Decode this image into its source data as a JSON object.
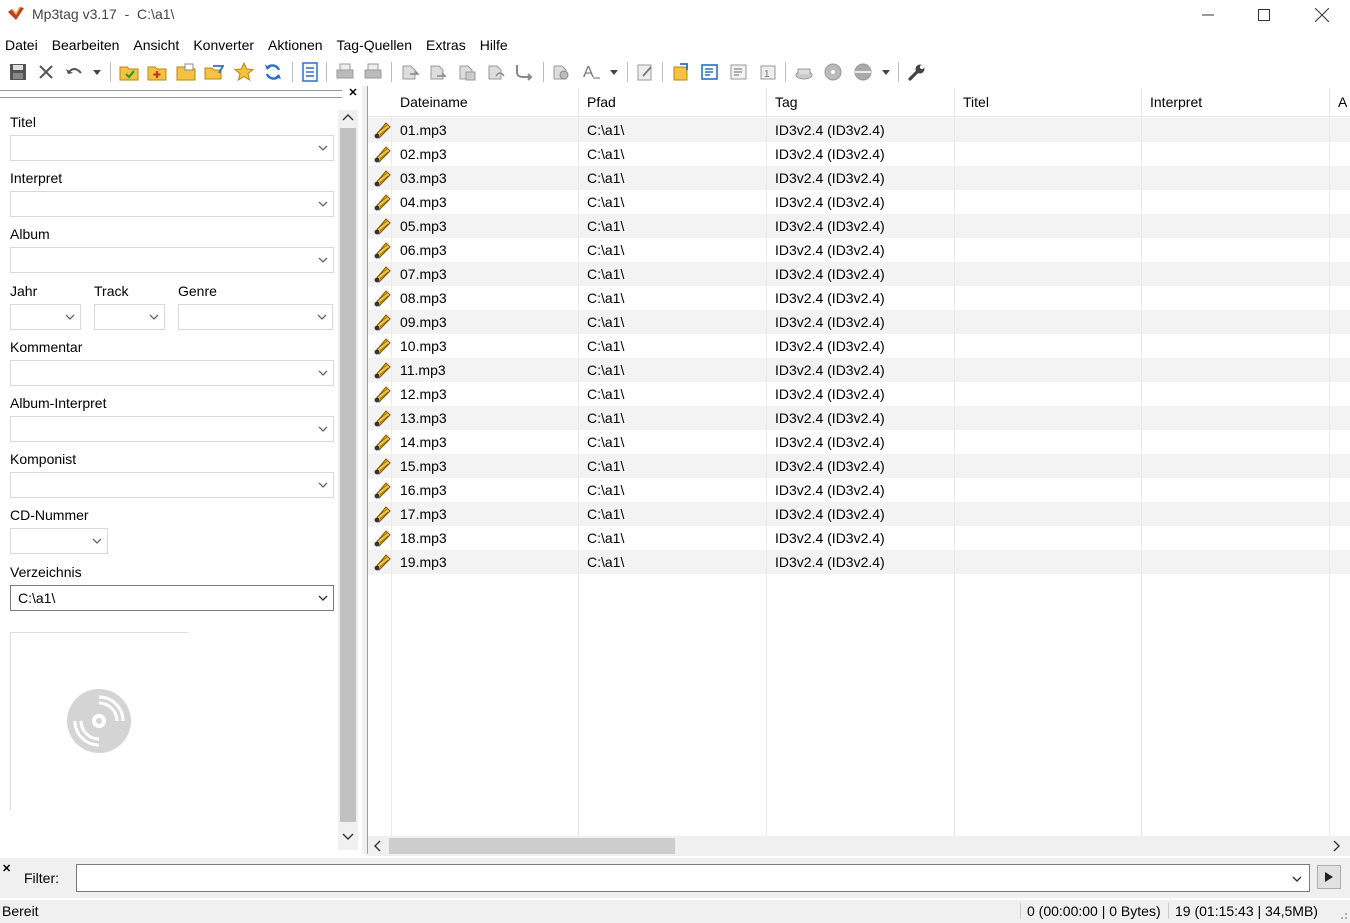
{
  "window": {
    "title": "Mp3tag v3.17  -  C:\\a1\\"
  },
  "menu": [
    "Datei",
    "Bearbeiten",
    "Ansicht",
    "Konverter",
    "Aktionen",
    "Tag-Quellen",
    "Extras",
    "Hilfe"
  ],
  "toolbar": {
    "icons": [
      "save-icon",
      "remove-tag-icon",
      "undo-icon",
      "change-directory-icon",
      "add-directory-icon",
      "favorites-folder-icon",
      "open-folder-icon",
      "favorites-star-icon",
      "refresh-icon",
      "tag-panel-icon",
      "print-icon",
      "print-preview-icon",
      "tag-filename-icon",
      "filename-tag-icon",
      "text-file-tag-icon",
      "tag-tag-icon",
      "filename-filename-icon",
      "actions-icon",
      "quick-action-icon",
      "extended-tags-icon",
      "playlist-icon",
      "export-icon",
      "import-icon",
      "autonumbering-icon",
      "freedb-icon",
      "discogs-icon",
      "tag-sources-icon",
      "options-icon"
    ]
  },
  "panel": {
    "labels": {
      "title": "Titel",
      "artist": "Interpret",
      "album": "Album",
      "year": "Jahr",
      "track": "Track",
      "genre": "Genre",
      "comment": "Kommentar",
      "album_artist": "Album-Interpret",
      "composer": "Komponist",
      "cd_number": "CD-Nummer",
      "directory": "Verzeichnis"
    },
    "directory_value": "C:\\a1\\"
  },
  "list": {
    "columns": [
      "Dateiname",
      "Pfad",
      "Tag",
      "Titel",
      "Interpret",
      "A"
    ],
    "rows": [
      {
        "file": "01.mp3",
        "path": "C:\\a1\\",
        "tag": "ID3v2.4 (ID3v2.4)"
      },
      {
        "file": "02.mp3",
        "path": "C:\\a1\\",
        "tag": "ID3v2.4 (ID3v2.4)"
      },
      {
        "file": "03.mp3",
        "path": "C:\\a1\\",
        "tag": "ID3v2.4 (ID3v2.4)"
      },
      {
        "file": "04.mp3",
        "path": "C:\\a1\\",
        "tag": "ID3v2.4 (ID3v2.4)"
      },
      {
        "file": "05.mp3",
        "path": "C:\\a1\\",
        "tag": "ID3v2.4 (ID3v2.4)"
      },
      {
        "file": "06.mp3",
        "path": "C:\\a1\\",
        "tag": "ID3v2.4 (ID3v2.4)"
      },
      {
        "file": "07.mp3",
        "path": "C:\\a1\\",
        "tag": "ID3v2.4 (ID3v2.4)"
      },
      {
        "file": "08.mp3",
        "path": "C:\\a1\\",
        "tag": "ID3v2.4 (ID3v2.4)"
      },
      {
        "file": "09.mp3",
        "path": "C:\\a1\\",
        "tag": "ID3v2.4 (ID3v2.4)"
      },
      {
        "file": "10.mp3",
        "path": "C:\\a1\\",
        "tag": "ID3v2.4 (ID3v2.4)"
      },
      {
        "file": "11.mp3",
        "path": "C:\\a1\\",
        "tag": "ID3v2.4 (ID3v2.4)"
      },
      {
        "file": "12.mp3",
        "path": "C:\\a1\\",
        "tag": "ID3v2.4 (ID3v2.4)"
      },
      {
        "file": "13.mp3",
        "path": "C:\\a1\\",
        "tag": "ID3v2.4 (ID3v2.4)"
      },
      {
        "file": "14.mp3",
        "path": "C:\\a1\\",
        "tag": "ID3v2.4 (ID3v2.4)"
      },
      {
        "file": "15.mp3",
        "path": "C:\\a1\\",
        "tag": "ID3v2.4 (ID3v2.4)"
      },
      {
        "file": "16.mp3",
        "path": "C:\\a1\\",
        "tag": "ID3v2.4 (ID3v2.4)"
      },
      {
        "file": "17.mp3",
        "path": "C:\\a1\\",
        "tag": "ID3v2.4 (ID3v2.4)"
      },
      {
        "file": "18.mp3",
        "path": "C:\\a1\\",
        "tag": "ID3v2.4 (ID3v2.4)"
      },
      {
        "file": "19.mp3",
        "path": "C:\\a1\\",
        "tag": "ID3v2.4 (ID3v2.4)"
      }
    ]
  },
  "filter": {
    "label": "Filter:",
    "value": ""
  },
  "status": {
    "text": "Bereit",
    "selection": "0 (00:00:00 | 0 Bytes)",
    "total": "19 (01:15:43 | 34,5MB)"
  },
  "colors": {
    "accent_orange": "#f0a020",
    "icon_blue": "#2a6fc9",
    "alt_row": "#f3f3f3"
  }
}
